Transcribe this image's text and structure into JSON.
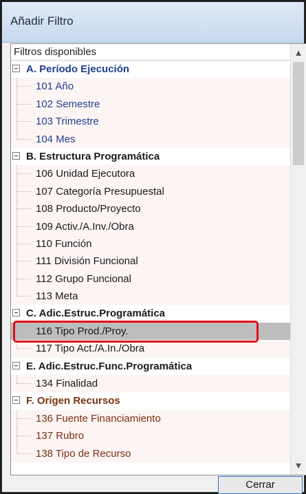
{
  "window": {
    "title": "Añadir Filtro"
  },
  "list": {
    "header": "Filtros disponibles",
    "rows": [
      {
        "kind": "group",
        "label": "A. Período Ejecución",
        "color": "#1f3f8f"
      },
      {
        "kind": "item",
        "label": "101 Año",
        "color": "#1f3f8f"
      },
      {
        "kind": "item",
        "label": "102 Semestre",
        "color": "#1f3f8f"
      },
      {
        "kind": "item",
        "label": "103 Trimestre",
        "color": "#1f3f8f"
      },
      {
        "kind": "item",
        "label": "104 Mes",
        "color": "#1f3f8f",
        "last": true
      },
      {
        "kind": "group",
        "label": "B. Estructura Programática",
        "color": "#1a1a1a"
      },
      {
        "kind": "item",
        "label": "106 Unidad Ejecutora",
        "color": "#1a1a1a"
      },
      {
        "kind": "item",
        "label": "107 Categoría Presupuestal",
        "color": "#1a1a1a"
      },
      {
        "kind": "item",
        "label": "108 Producto/Proyecto",
        "color": "#1a1a1a"
      },
      {
        "kind": "item",
        "label": "109 Activ./A.Inv./Obra",
        "color": "#1a1a1a"
      },
      {
        "kind": "item",
        "label": "110 Función",
        "color": "#1a1a1a"
      },
      {
        "kind": "item",
        "label": "111 División Funcional",
        "color": "#1a1a1a"
      },
      {
        "kind": "item",
        "label": "112 Grupo Funcional",
        "color": "#1a1a1a"
      },
      {
        "kind": "item",
        "label": "113 Meta",
        "color": "#1a1a1a",
        "last": true
      },
      {
        "kind": "group",
        "label": "C. Adic.Estruc.Programática",
        "color": "#1a1a1a"
      },
      {
        "kind": "item",
        "label": "116 Tipo Prod./Proy.",
        "color": "#1a1a1a",
        "selected": true
      },
      {
        "kind": "item",
        "label": "117 Tipo Act./A.In./Obra",
        "color": "#1a1a1a",
        "last": true
      },
      {
        "kind": "group",
        "label": "E. Adic.Estruc.Func.Programática",
        "color": "#1a1a1a"
      },
      {
        "kind": "item",
        "label": "134 Finalidad",
        "color": "#1a1a1a",
        "last": true
      },
      {
        "kind": "group",
        "label": "F. Origen Recursos",
        "color": "#7a3210"
      },
      {
        "kind": "item",
        "label": "136 Fuente Financiamiento",
        "color": "#7a3210"
      },
      {
        "kind": "item",
        "label": "137 Rubro",
        "color": "#7a3210"
      },
      {
        "kind": "item",
        "label": "138 Tipo de Recurso",
        "color": "#7a3210",
        "last": true
      }
    ]
  },
  "scroll": {
    "up_icon": "▲",
    "down_icon": "▼"
  },
  "buttons": {
    "close_label": "Cerrar"
  }
}
